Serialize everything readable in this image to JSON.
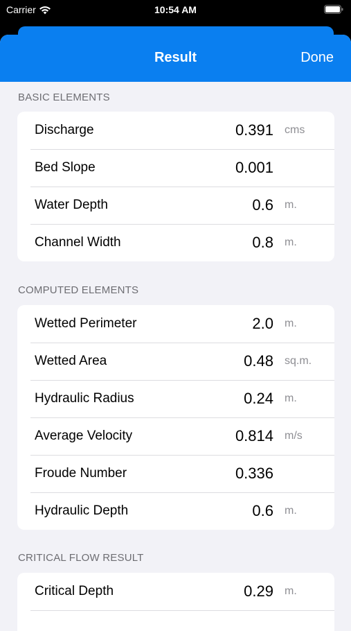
{
  "status_bar": {
    "carrier": "Carrier",
    "time": "10:54 AM"
  },
  "nav": {
    "title": "Result",
    "done_label": "Done"
  },
  "colors": {
    "accent": "#0a7ff0",
    "background": "#f2f2f7",
    "section_header": "#6d6d72",
    "unit": "#8e8e93"
  },
  "sections": [
    {
      "header": "BASIC ELEMENTS",
      "rows": [
        {
          "label": "Discharge",
          "value": "0.391",
          "unit": "cms"
        },
        {
          "label": "Bed Slope",
          "value": "0.001",
          "unit": ""
        },
        {
          "label": "Water Depth",
          "value": "0.6",
          "unit": "m."
        },
        {
          "label": "Channel Width",
          "value": "0.8",
          "unit": "m."
        }
      ]
    },
    {
      "header": "COMPUTED ELEMENTS",
      "rows": [
        {
          "label": "Wetted Perimeter",
          "value": "2.0",
          "unit": "m."
        },
        {
          "label": "Wetted Area",
          "value": "0.48",
          "unit": "sq.m."
        },
        {
          "label": "Hydraulic Radius",
          "value": "0.24",
          "unit": "m."
        },
        {
          "label": "Average Velocity",
          "value": "0.814",
          "unit": "m/s"
        },
        {
          "label": "Froude Number",
          "value": "0.336",
          "unit": ""
        },
        {
          "label": "Hydraulic Depth",
          "value": "0.6",
          "unit": "m."
        }
      ]
    },
    {
      "header": "CRITICAL FLOW RESULT",
      "rows": [
        {
          "label": "Critical Depth",
          "value": "0.29",
          "unit": "m."
        }
      ]
    }
  ]
}
